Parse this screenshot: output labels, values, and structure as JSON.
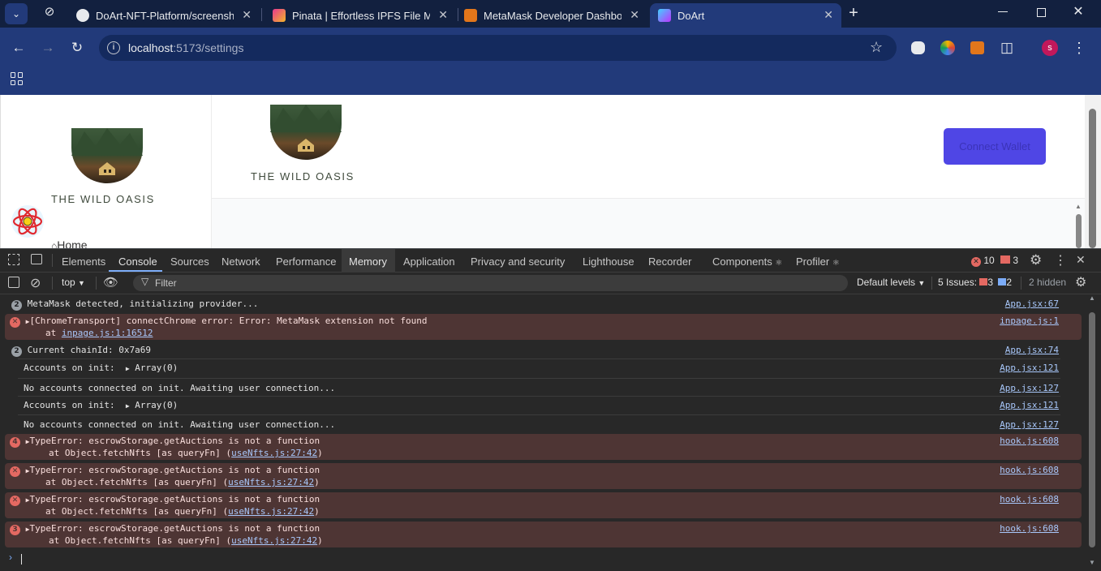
{
  "browser": {
    "tabs": [
      {
        "title": "DoArt-NFT-Platform/screenshot",
        "favicon": "github-icon"
      },
      {
        "title": "Pinata | Effortless IPFS File Mana",
        "favicon": "pinata-icon"
      },
      {
        "title": "MetaMask Developer Dashboar",
        "favicon": "metamask-icon"
      },
      {
        "title": "DoArt",
        "favicon": "vite-icon"
      }
    ],
    "url_host": "localhost",
    "url_path": ":5173/settings",
    "profile_initial": "s"
  },
  "page": {
    "sidebar_brand": "THE WILD OASIS",
    "header_brand": "THE WILD OASIS",
    "connect_button": "Connect Wallet",
    "nav_home": "Home"
  },
  "devtools": {
    "tabs": [
      "Elements",
      "Console",
      "Sources",
      "Network",
      "Performance",
      "Memory",
      "Application",
      "Privacy and security",
      "Lighthouse",
      "Recorder",
      "Components",
      "Profiler"
    ],
    "error_count": "10",
    "warning_count": "3",
    "context": "top",
    "filter_placeholder": "Filter",
    "levels": "Default levels",
    "issues_label": "5 Issues:",
    "issues_red": "3",
    "issues_blue": "2",
    "hidden": "2 hidden",
    "logs": [
      {
        "count": "2",
        "text": "MetaMask detected, initializing provider...",
        "source": "App.jsx:67"
      },
      {
        "text": "[ChromeTransport] connectChrome error: Error: MetaMask extension not found",
        "trace_prefix": "at ",
        "trace_link": "inpage.js:1:16512",
        "source": "inpage.js:1"
      },
      {
        "count": "2",
        "text": "Current chainId: 0x7a69",
        "source": "App.jsx:74"
      },
      {
        "text": "Accounts on init:",
        "value": "Array(0)",
        "source": "App.jsx:121"
      },
      {
        "text": "No accounts connected on init. Awaiting user connection...",
        "source": "App.jsx:127"
      },
      {
        "text": "Accounts on init:",
        "value": "Array(0)",
        "source": "App.jsx:121"
      },
      {
        "text": "No accounts connected on init. Awaiting user connection...",
        "source": "App.jsx:127"
      },
      {
        "count": "4",
        "text": "TypeError: escrowStorage.getAuctions is not a function",
        "trace_prefix": "at Object.fetchNfts [as queryFn] (",
        "trace_link": "useNfts.js:27:42",
        "trace_suffix": ")",
        "source": "hook.js:608"
      },
      {
        "text": "TypeError: escrowStorage.getAuctions is not a function",
        "trace_prefix": "at Object.fetchNfts [as queryFn] (",
        "trace_link": "useNfts.js:27:42",
        "trace_suffix": ")",
        "source": "hook.js:608"
      },
      {
        "text": "TypeError: escrowStorage.getAuctions is not a function",
        "trace_prefix": "at Object.fetchNfts [as queryFn] (",
        "trace_link": "useNfts.js:27:42",
        "trace_suffix": ")",
        "source": "hook.js:608"
      },
      {
        "count": "3",
        "text": "TypeError: escrowStorage.getAuctions is not a function",
        "trace_prefix": "at Object.fetchNfts [as queryFn] (",
        "trace_link": "useNfts.js:27:42",
        "trace_suffix": ")",
        "source": "hook.js:608"
      }
    ]
  },
  "colors": {
    "tabbar": "#12203f",
    "toolbar": "#223a7a",
    "connect_button": "#4f46e5",
    "brand_text": "#3f4a3c",
    "error_row": "#4e3534",
    "link": "#a8c7fa"
  }
}
